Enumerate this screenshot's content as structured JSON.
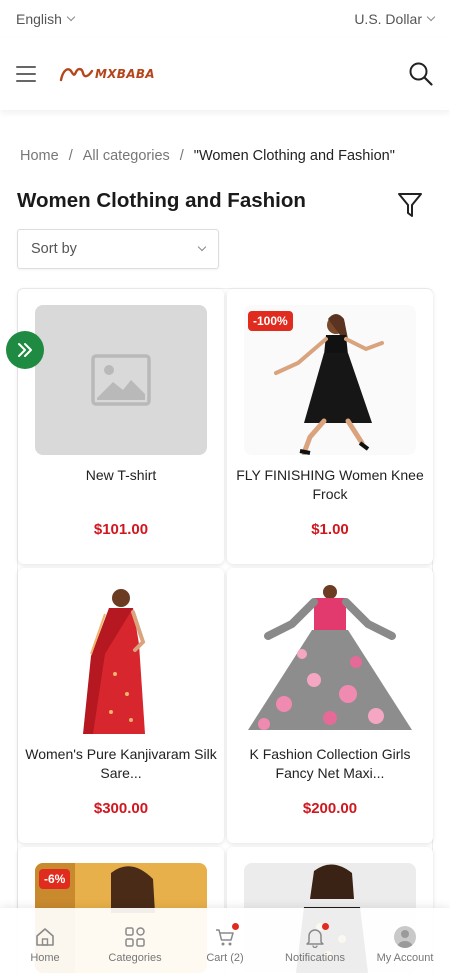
{
  "topbar": {
    "language": "English",
    "currency": "U.S. Dollar"
  },
  "header": {
    "logo_text": "MXBABA"
  },
  "breadcrumb": {
    "home": "Home",
    "sep": "/",
    "all": "All categories",
    "current": "\"Women Clothing and Fashion\""
  },
  "page": {
    "title": "Women Clothing and Fashion"
  },
  "sort": {
    "label": "Sort by"
  },
  "products": [
    {
      "name": "New T-shirt",
      "price": "$101.00",
      "badge": ""
    },
    {
      "name": "FLY FINISHING Women Knee Frock",
      "price": "$1.00",
      "badge": "-100%"
    },
    {
      "name": "Women's Pure Kanjivaram Silk Sare...",
      "price": "$300.00",
      "badge": ""
    },
    {
      "name": "K Fashion Collection Girls Fancy Net Maxi...",
      "price": "$200.00",
      "badge": ""
    },
    {
      "name": "",
      "price": "",
      "badge": "-6%"
    },
    {
      "name": "",
      "price": "",
      "badge": ""
    }
  ],
  "nav": {
    "home": "Home",
    "categories": "Categories",
    "cart": "Cart (2)",
    "notifications": "Notifications",
    "account": "My Account"
  },
  "colors": {
    "price": "#d0171f",
    "badge": "#e02b1f",
    "side_button": "#1f8a42",
    "logo": "#b5461c"
  }
}
